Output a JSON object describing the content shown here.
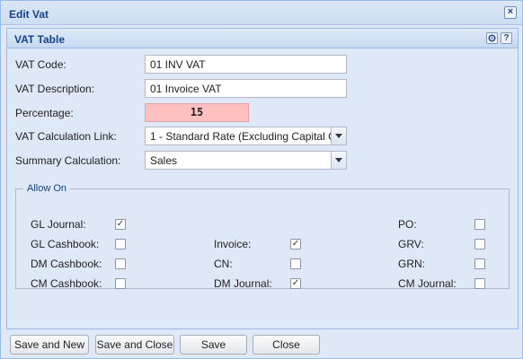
{
  "window": {
    "title": "Edit Vat",
    "close_glyph": "×"
  },
  "panel": {
    "title": "VAT Table",
    "tools": {
      "gear_icon": "gear-icon",
      "help_icon": "help-icon",
      "help_glyph": "?"
    }
  },
  "form": {
    "vat_code_label": "VAT Code:",
    "vat_code_value": "01 INV VAT",
    "vat_desc_label": "VAT Description:",
    "vat_desc_value": "01 Invoice VAT",
    "percentage_label": "Percentage:",
    "percentage_value": "15",
    "calc_link_label": "VAT Calculation Link:",
    "calc_link_value": "1 - Standard Rate (Excluding Capital G",
    "summary_calc_label": "Summary Calculation:",
    "summary_calc_value": "Sales"
  },
  "allow_on": {
    "legend": "Allow On",
    "check_glyph": "✓",
    "items": [
      {
        "label": "GL Journal:",
        "checked": true
      },
      {
        "label": "GL Cashbook:",
        "checked": false
      },
      {
        "label": "DM Cashbook:",
        "checked": false
      },
      {
        "label": "CM Cashbook:",
        "checked": false
      },
      {
        "label": "Invoice:",
        "checked": true
      },
      {
        "label": "CN:",
        "checked": false
      },
      {
        "label": "DM Journal:",
        "checked": true
      },
      {
        "label": "PO:",
        "checked": false
      },
      {
        "label": "GRV:",
        "checked": false
      },
      {
        "label": "GRN:",
        "checked": false
      },
      {
        "label": "CM Journal:",
        "checked": false
      }
    ]
  },
  "buttons": {
    "save_and_new": "Save and New",
    "save_and_close": "Save and Close",
    "save": "Save",
    "close": "Close"
  }
}
